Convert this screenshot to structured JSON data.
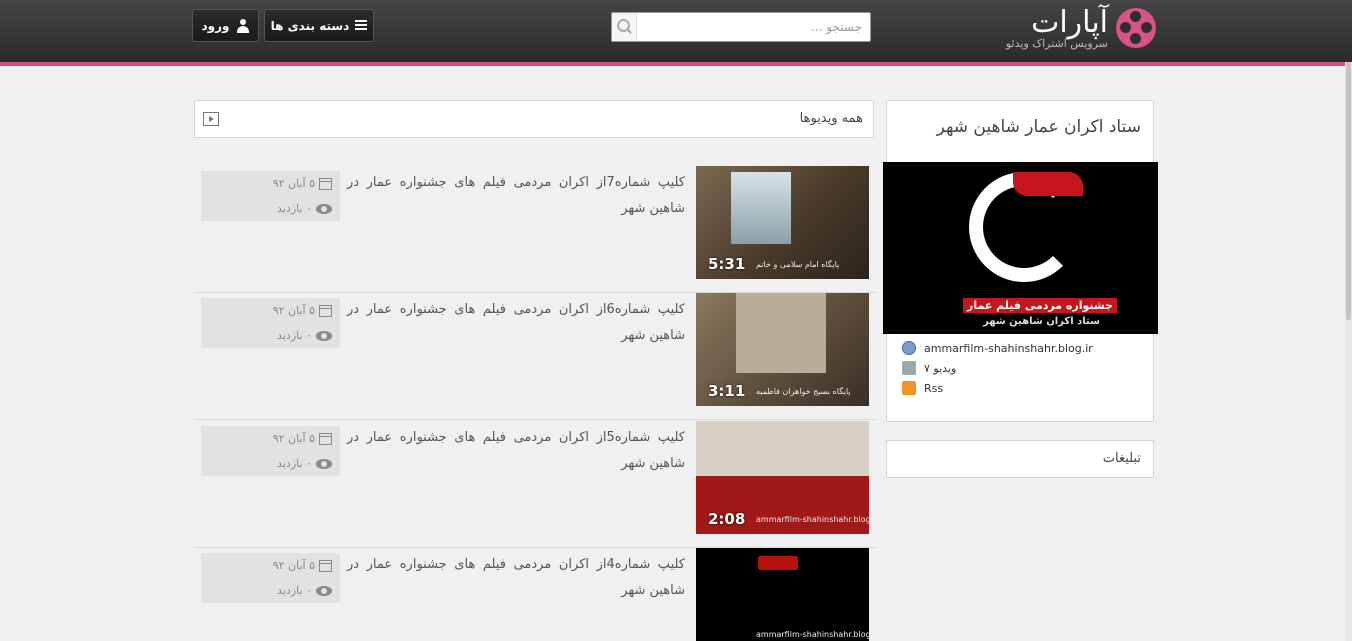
{
  "header": {
    "logo_text": "آپارات",
    "logo_subtitle": "سرویس اشتراک ویدئو",
    "search_placeholder": "جستجو ...",
    "categories_label": "دسته بندی ها",
    "login_label": "ورود",
    "accent_color": "#d54f87"
  },
  "main": {
    "section_title": "همه ویدیوها",
    "videos": [
      {
        "title": "کلیپ شماره7از اکران مردمی فیلم های جشنواره عمار در شاهین شهر",
        "date": "۵ آبان ۹۲",
        "views": "۰ بازدید",
        "duration": "5:31",
        "caption": "پایگاه امام سلامی و خاتم"
      },
      {
        "title": "کلیپ شماره6از اکران مردمی فیلم های جشنواره عمار در شاهین شهر",
        "date": "۵ آبان ۹۲",
        "views": "۰ بازدید",
        "duration": "3:11",
        "caption": "پایگاه بسیج خواهران فاطمیه"
      },
      {
        "title": "کلیپ شماره5از اکران مردمی فیلم های جشنواره عمار در شاهین شهر",
        "date": "۵ آبان ۹۲",
        "views": "۰ بازدید",
        "duration": "2:08",
        "caption": "ammarfilm-shahinshahr.blog.ir"
      },
      {
        "title": "کلیپ شماره4از اکران مردمی فیلم های جشنواره عمار در شاهین شهر",
        "date": "۵ آبان ۹۲",
        "views": "۰ بازدید",
        "duration": "",
        "caption": "ammarfilm-shahinshahr.blog.ir"
      }
    ]
  },
  "sidebar": {
    "channel_title": "ستاد اکران عمار شاهین شهر",
    "channel_image_line1": "جشنواره مردمی فیلم عمار",
    "channel_image_line2": "ستاد اکران شاهین شهر",
    "website": "ammarfilm-shahinshahr.blog.ir",
    "video_count": "۷ ویدیو",
    "rss_label": "Rss",
    "ads_title": "تبلیغات"
  }
}
